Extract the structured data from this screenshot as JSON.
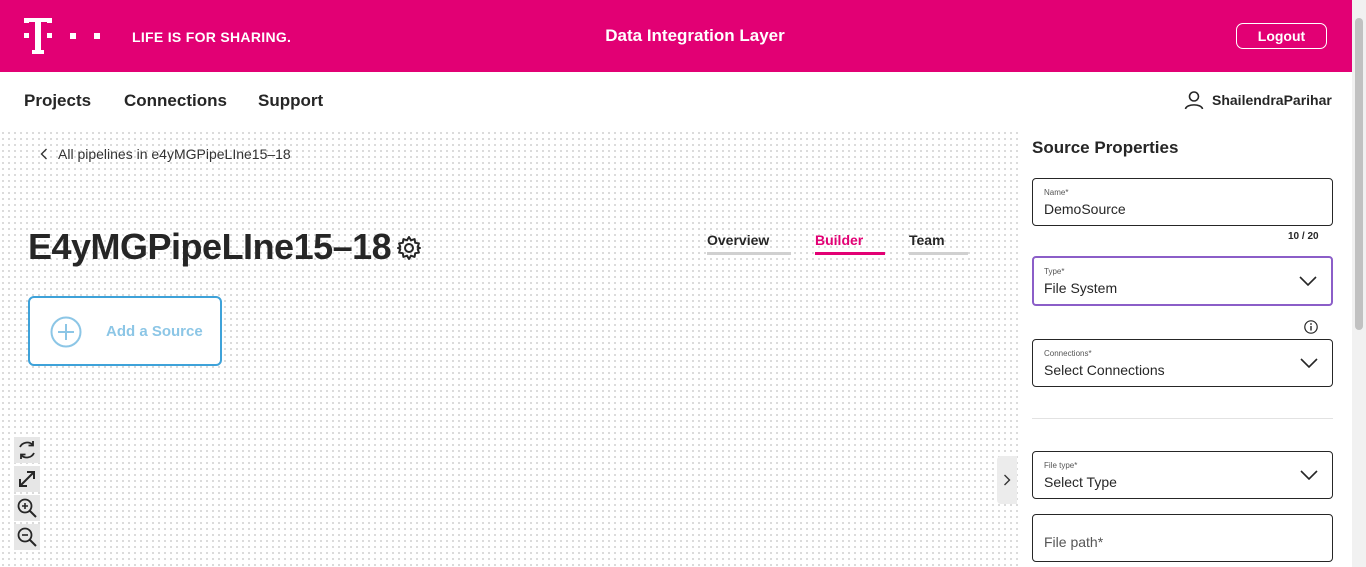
{
  "header": {
    "tagline": "LIFE IS FOR SHARING.",
    "app_title": "Data Integration Layer",
    "logout_label": "Logout",
    "brand_color": "#e20074"
  },
  "nav": {
    "items": [
      "Projects",
      "Connections",
      "Support"
    ],
    "user_name": "ShailendraParihar"
  },
  "canvas": {
    "breadcrumb": "All pipelines in e4yMGPipeLIne15–18",
    "pipeline_title": "E4yMGPipeLIne15–18",
    "tabs": [
      {
        "label": "Overview",
        "active": false
      },
      {
        "label": "Builder",
        "active": true
      },
      {
        "label": "Team",
        "active": false
      }
    ],
    "add_source_label": "Add a Source",
    "tools": [
      "refresh-icon",
      "fit-to-screen-icon",
      "zoom-in-icon",
      "zoom-out-icon"
    ]
  },
  "panel": {
    "title": "Source Properties",
    "name_field": {
      "label": "Name*",
      "value": "DemoSource",
      "counter": "10 / 20"
    },
    "type_field": {
      "label": "Type*",
      "value": "File System"
    },
    "connections_field": {
      "label": "Connections*",
      "value": "Select Connections"
    },
    "file_type_field": {
      "label": "File type*",
      "value": "Select Type"
    },
    "file_path_field": {
      "placeholder": "File path*"
    }
  }
}
